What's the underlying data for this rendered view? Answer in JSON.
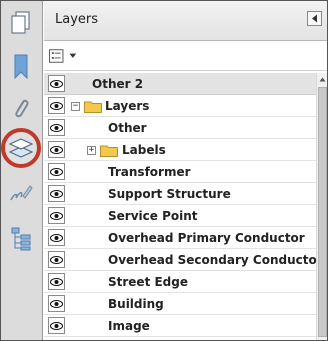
{
  "panel": {
    "title": "Layers"
  },
  "rail": {
    "items": [
      {
        "name": "pages-icon"
      },
      {
        "name": "bookmark-icon"
      },
      {
        "name": "attachment-icon"
      },
      {
        "name": "layers-icon",
        "selected": true
      },
      {
        "name": "signatures-icon"
      },
      {
        "name": "model-tree-icon"
      }
    ]
  },
  "layers": {
    "header": "Other 2",
    "root": "Layers",
    "items": [
      "Other",
      "Labels",
      "Transformer",
      "Support Structure",
      "Service Point",
      "Overhead Primary Conductor",
      "Overhead Secondary Conductor",
      "Street Edge",
      "Building",
      "Image"
    ]
  },
  "colors": {
    "highlight_ring": "#c0392b",
    "folder": "#f2c94c"
  }
}
